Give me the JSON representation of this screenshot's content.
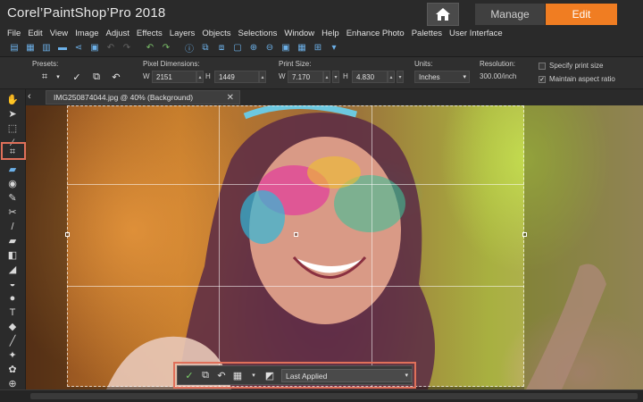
{
  "app": {
    "title": "Corel’PaintShop’Pro 2018"
  },
  "workspace_tabs": {
    "manage": "Manage",
    "edit": "Edit",
    "active": "Edit",
    "accent_color": "#f07d22"
  },
  "menu": [
    "File",
    "Edit",
    "View",
    "Image",
    "Adjust",
    "Effects",
    "Layers",
    "Objects",
    "Selections",
    "Window",
    "Help",
    "Enhance Photo",
    "Palettes",
    "User Interface"
  ],
  "options": {
    "presets_label": "Presets:",
    "pixel_dimensions_label": "Pixel Dimensions:",
    "w_label": "W",
    "h_label": "H",
    "pixel_w": "2151",
    "pixel_h": "1449",
    "print_size_label": "Print Size:",
    "print_w": "7.170",
    "print_h": "4.830",
    "units_label": "Units:",
    "units_value": "Inches",
    "resolution_label": "Resolution:",
    "resolution_value": "300.00/inch",
    "specify_print_size": "Specify print size",
    "specify_print_size_checked": false,
    "maintain_aspect": "Maintain aspect ratio",
    "maintain_aspect_checked": true
  },
  "document": {
    "tab_label": "IMG250874044.jpg @  40% (Background)"
  },
  "crop_toolbar": {
    "preset": "Last Applied"
  },
  "highlight_color": "#e0705a"
}
